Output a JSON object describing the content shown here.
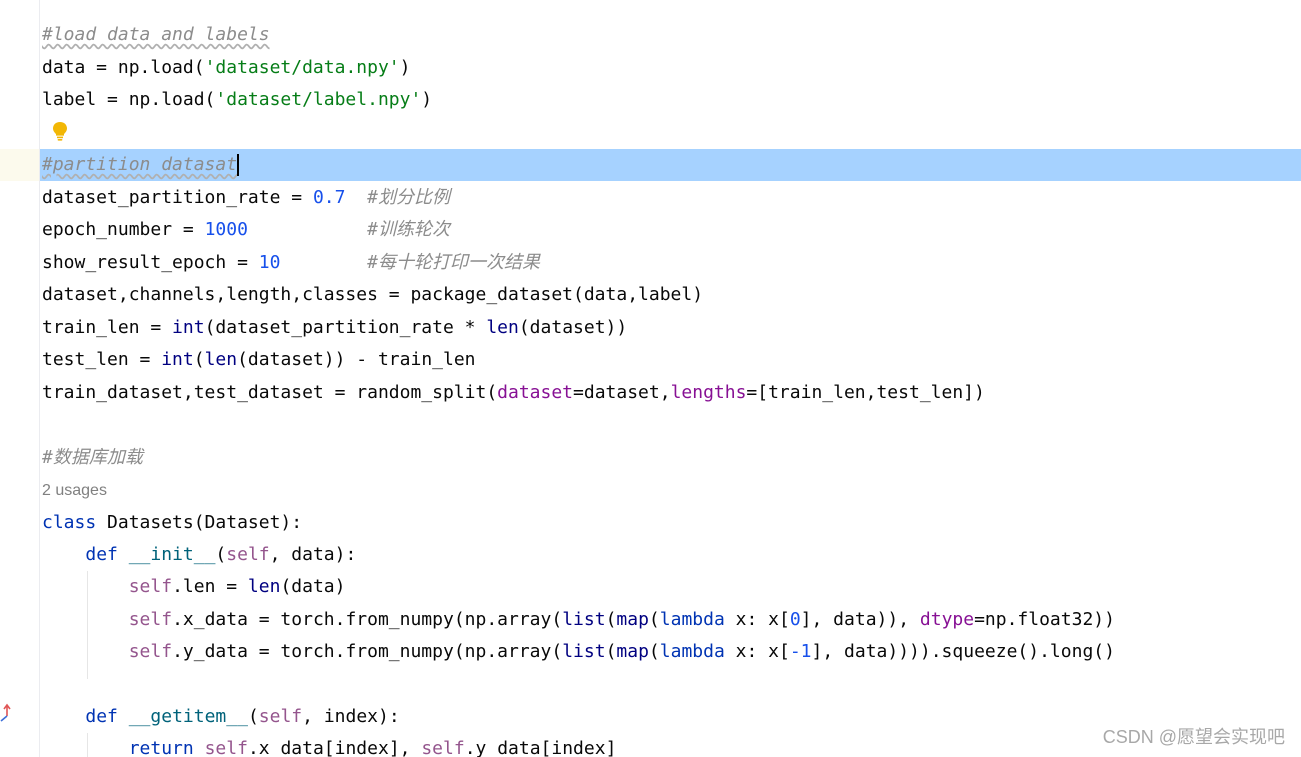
{
  "editor": {
    "lines": [
      {
        "segments": [
          {
            "text": "#load data and labels",
            "style": "comment"
          }
        ]
      },
      {
        "segments": [
          {
            "text": "data = np.load(",
            "style": "plain"
          },
          {
            "text": "'dataset/data.npy'",
            "style": "string"
          },
          {
            "text": ")",
            "style": "plain"
          }
        ]
      },
      {
        "segments": [
          {
            "text": "label = np.load(",
            "style": "plain"
          },
          {
            "text": "'dataset/label.npy'",
            "style": "string"
          },
          {
            "text": ")",
            "style": "plain"
          }
        ]
      },
      {
        "segments": []
      },
      {
        "segments": [
          {
            "text": "#partition datasat",
            "style": "comment"
          }
        ],
        "current": true
      },
      {
        "segments": [
          {
            "text": "dataset_partition_rate = ",
            "style": "plain"
          },
          {
            "text": "0.7",
            "style": "number"
          },
          {
            "text": "  ",
            "style": "plain"
          },
          {
            "text": "#划分比例",
            "style": "comment"
          }
        ]
      },
      {
        "segments": [
          {
            "text": "epoch_number = ",
            "style": "plain"
          },
          {
            "text": "1000",
            "style": "number"
          },
          {
            "text": "           ",
            "style": "plain"
          },
          {
            "text": "#训练轮次",
            "style": "comment"
          }
        ]
      },
      {
        "segments": [
          {
            "text": "show_result_epoch = ",
            "style": "plain"
          },
          {
            "text": "10",
            "style": "number"
          },
          {
            "text": "        ",
            "style": "plain"
          },
          {
            "text": "#每十轮打印一次结果",
            "style": "comment"
          }
        ]
      },
      {
        "segments": [
          {
            "text": "dataset,channels,length,classes = package_dataset(data,label)",
            "style": "plain"
          }
        ]
      },
      {
        "segments": [
          {
            "text": "train_len = ",
            "style": "plain"
          },
          {
            "text": "int",
            "style": "builtin"
          },
          {
            "text": "(dataset_partition_rate * ",
            "style": "plain"
          },
          {
            "text": "len",
            "style": "builtin"
          },
          {
            "text": "(dataset))",
            "style": "plain"
          }
        ]
      },
      {
        "segments": [
          {
            "text": "test_len = ",
            "style": "plain"
          },
          {
            "text": "int",
            "style": "builtin"
          },
          {
            "text": "(",
            "style": "plain"
          },
          {
            "text": "len",
            "style": "builtin"
          },
          {
            "text": "(dataset)) - train_len",
            "style": "plain"
          }
        ]
      },
      {
        "segments": [
          {
            "text": "train_dataset,test_dataset = random_split(",
            "style": "plain"
          },
          {
            "text": "dataset",
            "style": "param"
          },
          {
            "text": "=dataset,",
            "style": "plain"
          },
          {
            "text": "lengths",
            "style": "param"
          },
          {
            "text": "=[train_len,test_len])",
            "style": "plain"
          }
        ]
      },
      {
        "segments": []
      },
      {
        "segments": [
          {
            "text": "#数据库加载",
            "style": "comment"
          }
        ]
      },
      {
        "segments": [
          {
            "text": "2 usages",
            "style": "hint"
          }
        ]
      },
      {
        "segments": [
          {
            "text": "class",
            "style": "keyword"
          },
          {
            "text": " Datasets(Dataset):",
            "style": "plain"
          }
        ]
      },
      {
        "segments": [
          {
            "text": "    ",
            "style": "plain"
          },
          {
            "text": "def",
            "style": "keyword"
          },
          {
            "text": " ",
            "style": "plain"
          },
          {
            "text": "__init__",
            "style": "fndef"
          },
          {
            "text": "(",
            "style": "plain"
          },
          {
            "text": "self",
            "style": "self"
          },
          {
            "text": ", data):",
            "style": "plain"
          }
        ]
      },
      {
        "segments": [
          {
            "text": "        ",
            "style": "plain"
          },
          {
            "text": "self",
            "style": "self"
          },
          {
            "text": ".len = ",
            "style": "plain"
          },
          {
            "text": "len",
            "style": "builtin"
          },
          {
            "text": "(data)",
            "style": "plain"
          }
        ]
      },
      {
        "segments": [
          {
            "text": "        ",
            "style": "plain"
          },
          {
            "text": "self",
            "style": "self"
          },
          {
            "text": ".x_data = torch.from_numpy(np.array(",
            "style": "plain"
          },
          {
            "text": "list",
            "style": "builtin"
          },
          {
            "text": "(",
            "style": "plain"
          },
          {
            "text": "map",
            "style": "builtin"
          },
          {
            "text": "(",
            "style": "plain"
          },
          {
            "text": "lambda",
            "style": "keyword"
          },
          {
            "text": " x: x[",
            "style": "plain"
          },
          {
            "text": "0",
            "style": "number"
          },
          {
            "text": "], data)), ",
            "style": "plain"
          },
          {
            "text": "dtype",
            "style": "param"
          },
          {
            "text": "=np.float32))",
            "style": "plain"
          }
        ]
      },
      {
        "segments": [
          {
            "text": "        ",
            "style": "plain"
          },
          {
            "text": "self",
            "style": "self"
          },
          {
            "text": ".y_data = torch.from_numpy(np.array(",
            "style": "plain"
          },
          {
            "text": "list",
            "style": "builtin"
          },
          {
            "text": "(",
            "style": "plain"
          },
          {
            "text": "map",
            "style": "builtin"
          },
          {
            "text": "(",
            "style": "plain"
          },
          {
            "text": "lambda",
            "style": "keyword"
          },
          {
            "text": " x: x[",
            "style": "plain"
          },
          {
            "text": "-1",
            "style": "number"
          },
          {
            "text": "], data)))).squeeze().long()",
            "style": "plain"
          }
        ]
      },
      {
        "segments": []
      },
      {
        "segments": [
          {
            "text": "    ",
            "style": "plain"
          },
          {
            "text": "def",
            "style": "keyword"
          },
          {
            "text": " ",
            "style": "plain"
          },
          {
            "text": "__getitem__",
            "style": "fndef"
          },
          {
            "text": "(",
            "style": "plain"
          },
          {
            "text": "self",
            "style": "self"
          },
          {
            "text": ", index):",
            "style": "plain"
          }
        ]
      },
      {
        "segments": [
          {
            "text": "        ",
            "style": "plain"
          },
          {
            "text": "return",
            "style": "keyword"
          },
          {
            "text": " ",
            "style": "plain"
          },
          {
            "text": "self",
            "style": "self"
          },
          {
            "text": ".x_data[index], ",
            "style": "plain"
          },
          {
            "text": "self",
            "style": "self"
          },
          {
            "text": ".y_data[index]",
            "style": "plain"
          }
        ]
      }
    ]
  },
  "watermark": "CSDN @愿望会实现吧",
  "icons": {
    "intention": "lightbulb-icon",
    "gutter": "override-arrow-icon"
  },
  "colors": {
    "current_line": "#a6d2ff",
    "comment": "#8c8c8c",
    "string": "#067d17",
    "number": "#1750eb",
    "keyword": "#0033b3",
    "self": "#94558d",
    "param": "#871094"
  }
}
